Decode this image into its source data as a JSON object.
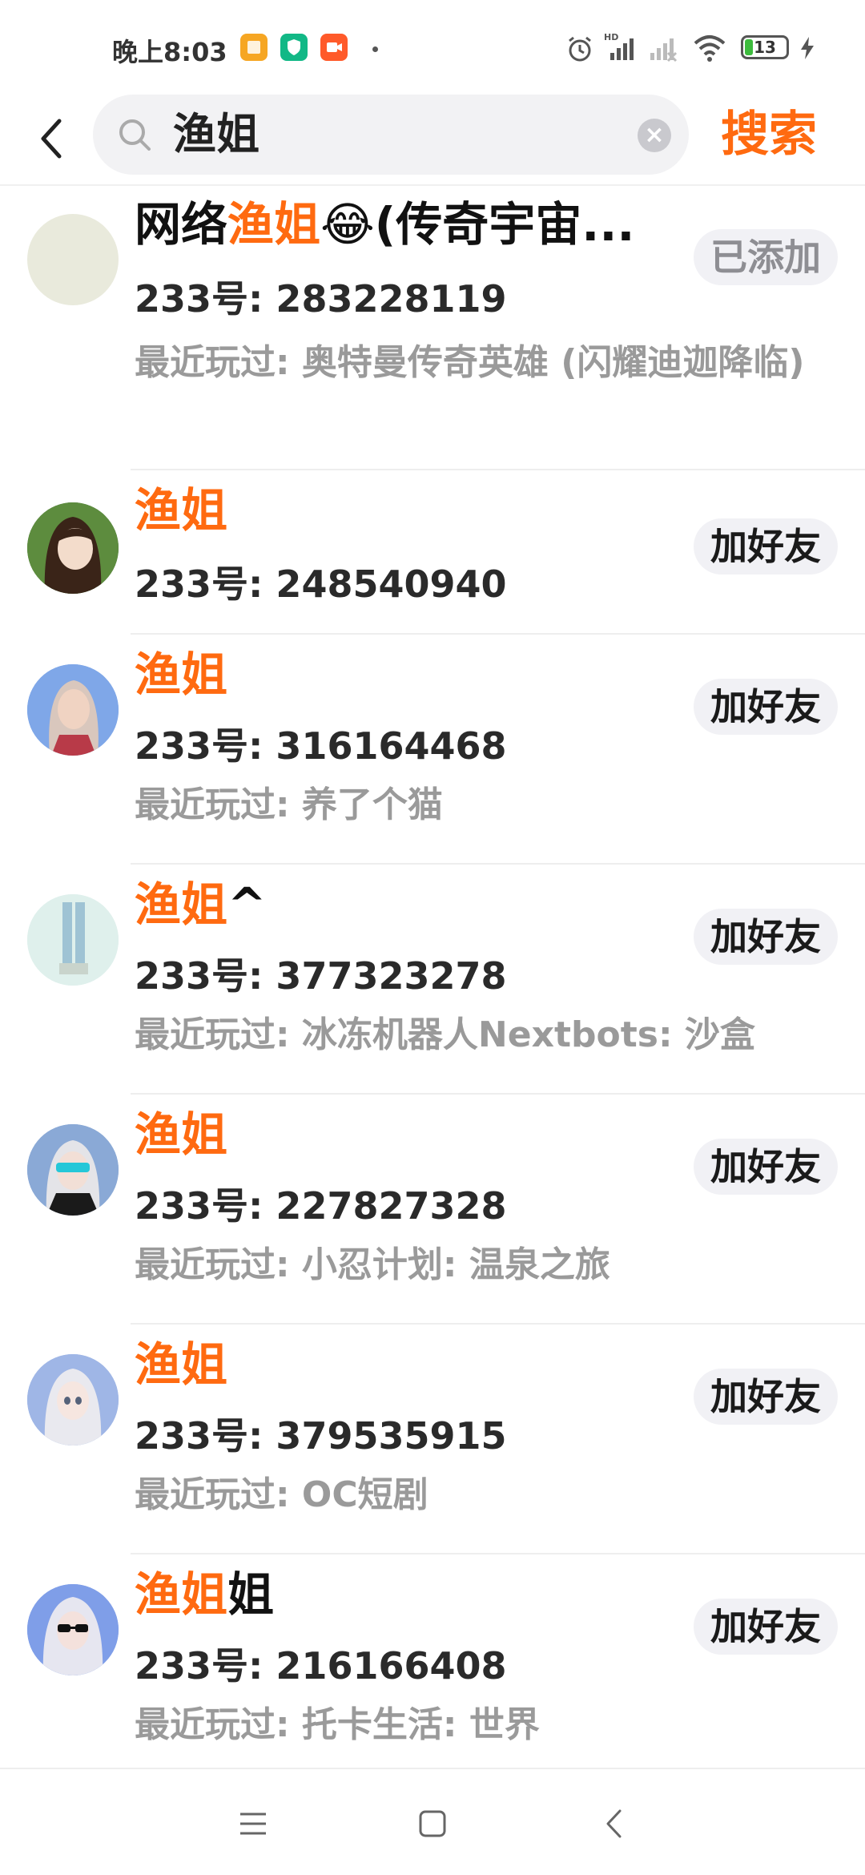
{
  "status_bar": {
    "time": "晚上8:03",
    "battery": "13",
    "app_icon_colors": [
      "#f6a623",
      "#12b886",
      "#ff5a2a"
    ]
  },
  "search": {
    "query": "渔姐",
    "button_label": "搜索"
  },
  "colors": {
    "accent": "#ff6a10"
  },
  "results": [
    {
      "name_before": "网络",
      "name_highlight": "渔姐",
      "name_after": "😂(传奇宇宙...",
      "uid": "233号: 283228119",
      "recent": "最近玩过: 奥特曼传奇英雄 (闪耀迪迦降临)",
      "action": "已添加",
      "action_state": "added"
    },
    {
      "name_before": "",
      "name_highlight": "渔姐",
      "name_after": "",
      "uid": "233号: 248540940",
      "recent": "",
      "action": "加好友",
      "action_state": "add"
    },
    {
      "name_before": "",
      "name_highlight": "渔姐",
      "name_after": "",
      "uid": "233号: 316164468",
      "recent": "最近玩过: 养了个猫",
      "action": "加好友",
      "action_state": "add"
    },
    {
      "name_before": "",
      "name_highlight": "渔姐",
      "name_after": "^",
      "uid": "233号: 377323278",
      "recent": "最近玩过: 冰冻机器人Nextbots: 沙盒",
      "action": "加好友",
      "action_state": "add"
    },
    {
      "name_before": "",
      "name_highlight": "渔姐",
      "name_after": "",
      "uid": "233号: 227827328",
      "recent": "最近玩过: 小忍计划: 温泉之旅",
      "action": "加好友",
      "action_state": "add"
    },
    {
      "name_before": "",
      "name_highlight": "渔姐",
      "name_after": "",
      "uid": "233号: 379535915",
      "recent": "最近玩过: OC短剧",
      "action": "加好友",
      "action_state": "add"
    },
    {
      "name_before": "",
      "name_highlight": "渔姐",
      "name_after": "姐",
      "uid": "233号: 216166408",
      "recent": "最近玩过: 托卡生活: 世界",
      "action": "加好友",
      "action_state": "add"
    }
  ],
  "nav": {
    "icons": [
      "menu-icon",
      "home-square-icon",
      "back-triangle-icon"
    ]
  }
}
